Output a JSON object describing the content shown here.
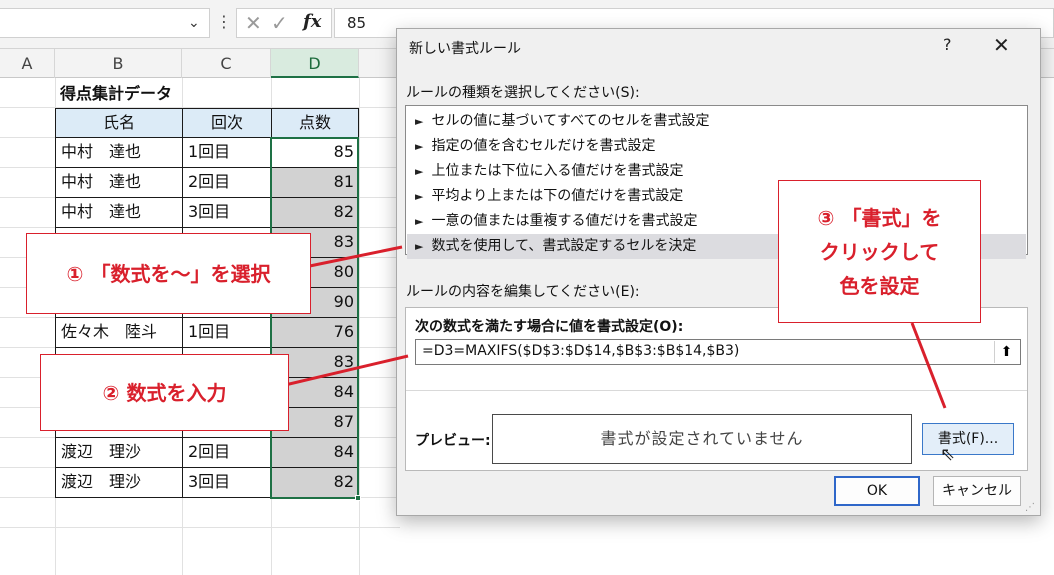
{
  "formula_bar": {
    "fx_label": "fx",
    "cancel_glyph": "✕",
    "enter_glyph": "✓",
    "value": "85"
  },
  "grid": {
    "columns": [
      "A",
      "B",
      "C",
      "D"
    ],
    "title": "得点集計データ",
    "headers": [
      "氏名",
      "回次",
      "点数"
    ],
    "rows": [
      {
        "name": "中村　達也",
        "round": "1回目",
        "score": "85"
      },
      {
        "name": "中村　達也",
        "round": "2回目",
        "score": "81"
      },
      {
        "name": "中村　達也",
        "round": "3回目",
        "score": "82"
      },
      {
        "name": "",
        "round": "",
        "score": "83"
      },
      {
        "name": "",
        "round": "",
        "score": "80"
      },
      {
        "name": "",
        "round": "",
        "score": "90"
      },
      {
        "name": "佐々木　陸斗",
        "round": "1回目",
        "score": "76"
      },
      {
        "name": "",
        "round": "",
        "score": "83"
      },
      {
        "name": "",
        "round": "",
        "score": "84"
      },
      {
        "name": "",
        "round": "",
        "score": "87"
      },
      {
        "name": "渡辺　理沙",
        "round": "2回目",
        "score": "84"
      },
      {
        "name": "渡辺　理沙",
        "round": "3回目",
        "score": "82"
      }
    ],
    "accent_color": "#1e7145"
  },
  "dialog": {
    "title": "新しい書式ルール",
    "help": "?",
    "close": "✕",
    "rule_type_label": "ルールの種類を選択してください(S):",
    "rule_types": [
      "セルの値に基づいてすべてのセルを書式設定",
      "指定の値を含むセルだけを書式設定",
      "上位または下位に入る値だけを書式設定",
      "平均より上または下の値だけを書式設定",
      "一意の値または重複する値だけを書式設定",
      "数式を使用して、書式設定するセルを決定"
    ],
    "edit_label": "ルールの内容を編集してください(E):",
    "formula_label": "次の数式を満たす場合に値を書式設定(O):",
    "formula_value": "=D3=MAXIFS($D$3:$D$14,$B$3:$B$14,$B3)",
    "preview_label": "プレビュー:",
    "preview_text": "書式が設定されていません",
    "format_button": "書式(F)...",
    "ok": "OK",
    "cancel": "キャンセル"
  },
  "callouts": {
    "step1": "① 「数式を～」を選択",
    "step2": "② 数式を入力",
    "step3_line1": "③ 「書式」を",
    "step3_line2": "クリックして",
    "step3_line3": "色を設定",
    "color": "#d9202c"
  }
}
